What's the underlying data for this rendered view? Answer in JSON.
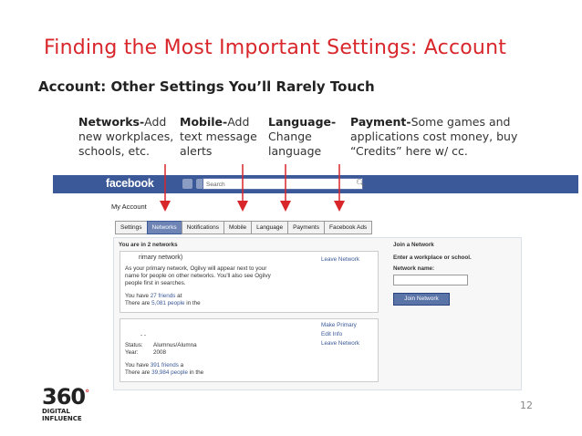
{
  "slide": {
    "title": "Finding the Most Important Settings: Account",
    "subtitle": "Account: Other Settings You’ll Rarely Touch",
    "page_number": "12"
  },
  "annotations": [
    {
      "head": "Networks-",
      "text": "Add new workplaces, schools, etc."
    },
    {
      "head": "Mobile-",
      "text": "Add text message alerts"
    },
    {
      "head": "Language-",
      "text": "Change language"
    },
    {
      "head": "Payment-",
      "text": "Some games and applications cost money, buy “Credits” here w/ cc."
    }
  ],
  "colors": {
    "title_red": "#d8262b",
    "fb_blue": "#3b5998",
    "tab_active": "#6d84b4"
  },
  "facebook": {
    "logo": "facebook",
    "search_placeholder": "Search",
    "my_account": "My Account",
    "tabs": [
      "Settings",
      "Networks",
      "Notifications",
      "Mobile",
      "Language",
      "Payments",
      "Facebook Ads"
    ],
    "active_tab": "Networks",
    "networks_header": "You are in 2 networks",
    "net1": {
      "title": "rimary network)",
      "desc": [
        "As your primary network, Ogilvy will appear next to your",
        "name for people on other networks. You'll also see Ogilvy",
        "people first in searches."
      ],
      "friends_prefix": "You have ",
      "friends_link": "27 friends",
      "friends_suffix": " at",
      "people_prefix": "There are ",
      "people_link": "5,081 people",
      "people_suffix": " in the",
      "leave": "Leave Network"
    },
    "net2": {
      "dots": "-    -",
      "status_label": "Status:",
      "status_value": "Alumnus/Alumna",
      "year_label": "Year:",
      "year_value": "2008",
      "friends_prefix": "You have ",
      "friends_link": "391 friends",
      "friends_suffix": " a",
      "people_prefix": "There are ",
      "people_link": "39,984 people",
      "people_suffix": " in the",
      "make_primary": "Make Primary",
      "edit_info": "Edit Info",
      "leave": "Leave Network"
    },
    "join": {
      "header": "Join a Network",
      "prompt": "Enter a workplace or school.",
      "label": "Network name:",
      "button": "Join Network"
    }
  },
  "logo": {
    "number": "360",
    "line1": "DIGITAL",
    "line2": "INFLUENCE"
  }
}
